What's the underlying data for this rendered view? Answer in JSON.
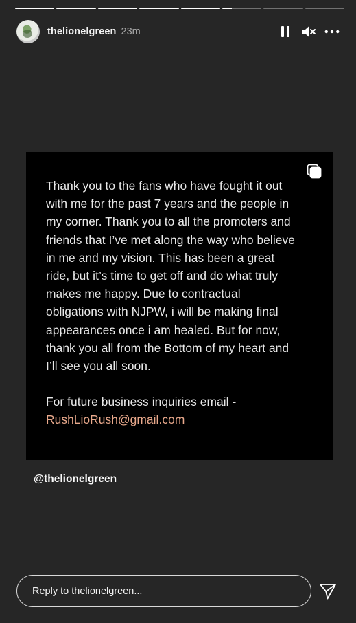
{
  "story": {
    "segments_total": 8,
    "segments_seen": 5,
    "current_segment_progress": 0.25
  },
  "header": {
    "username": "thelionelgreen",
    "time_ago": "23m",
    "icons": {
      "avatar": "profile-photo",
      "pause": "pause-icon",
      "mute": "speaker-muted-icon",
      "more": "more-options-icon"
    }
  },
  "post": {
    "lines": [
      "Thank you to the fans who have fought it out",
      "with me for the past 7 years and the people in",
      "my corner. Thank you to all the promoters and",
      "friends that I’ve met along the way who believe",
      "in me and my vision. This has been a great",
      "ride, but it’s time to get off and do what truly",
      "makes me happy. Due to contractual",
      "obligations with NJPW, i will be making final",
      "appearances once i am healed. But for now,",
      "thank you all from the Bottom of my heart and",
      "I’ll see you all soon."
    ],
    "inquiry_label": "For future business inquiries email -",
    "email": "RushLioRush@gmail.com",
    "email_color": "#e9a98c",
    "copy_icon": "copy-icon"
  },
  "mention": "@thelionelgreen",
  "reply": {
    "placeholder": "Reply to thelionelgreen...",
    "send_icon": "paper-plane-icon"
  },
  "colors": {
    "background": "#262626",
    "card": "#000000",
    "text": "#e8e8e8"
  }
}
